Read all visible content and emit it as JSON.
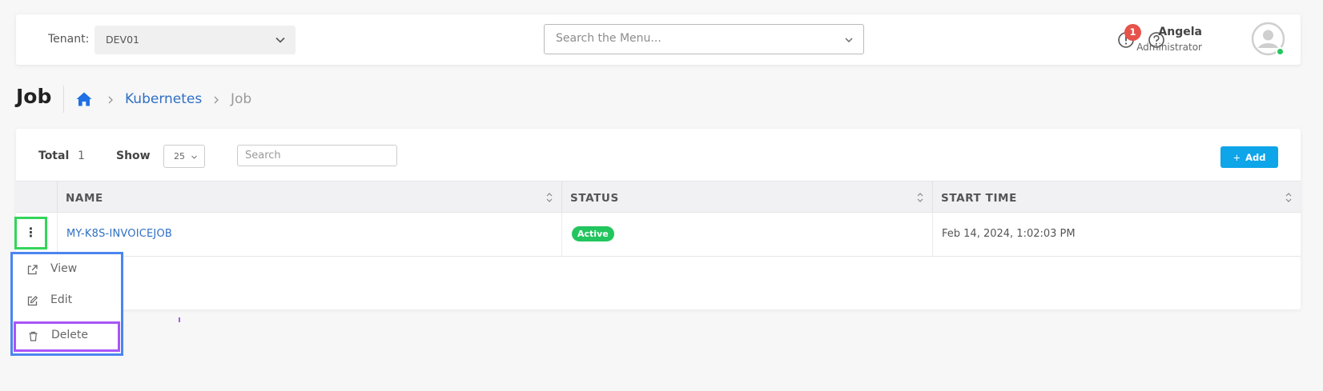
{
  "header": {
    "tenant_label": "Tenant:",
    "tenant_value": "DEV01",
    "menu_search_placeholder": "Search the Menu...",
    "notification_count": "1",
    "user_name": "Angela",
    "user_role": "Administrator"
  },
  "breadcrumb": {
    "page_title": "Job",
    "items": [
      "Kubernetes",
      "Job"
    ],
    "separator": ">"
  },
  "toolbar": {
    "total_label": "Total",
    "total_value": "1",
    "show_label": "Show",
    "page_size": "25",
    "search_placeholder": "Search",
    "add_label": "Add",
    "add_icon": "+"
  },
  "table": {
    "columns": [
      "NAME",
      "STATUS",
      "START TIME"
    ],
    "rows": [
      {
        "name": "MY-K8S-INVOICEJOB",
        "status": "Active",
        "start_time": "Feb 14, 2024, 1:02:03 PM"
      }
    ]
  },
  "row_menu": {
    "kebab": "⋮",
    "items": [
      "View",
      "Edit",
      "Delete"
    ]
  },
  "colors": {
    "link": "#2f6fc4",
    "status_active": "#22c55e",
    "add_button": "#0ea5e9",
    "notification_badge": "#e5534b",
    "highlight_green": "#34d55a",
    "highlight_blue": "#4b85f0",
    "highlight_purple": "#a955f7"
  }
}
